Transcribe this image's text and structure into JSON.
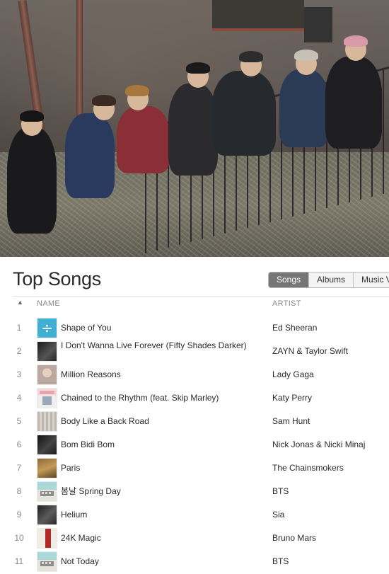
{
  "header": {
    "title": "Top Songs",
    "tabs": [
      {
        "label": "Songs",
        "active": true
      },
      {
        "label": "Albums",
        "active": false
      },
      {
        "label": "Music V",
        "active": false
      }
    ]
  },
  "table": {
    "columns": {
      "name": "NAME",
      "artist": "ARTIST"
    },
    "sort_indicator": "▲",
    "rows": [
      {
        "rank": "1",
        "name": "Shape of You",
        "artist": "Ed Sheeran"
      },
      {
        "rank": "2",
        "name": "I Don't Wanna Live Forever (Fifty Shades Darker)",
        "artist": "ZAYN & Taylor Swift"
      },
      {
        "rank": "3",
        "name": "Million Reasons",
        "artist": "Lady Gaga"
      },
      {
        "rank": "4",
        "name": "Chained to the Rhythm (feat. Skip Marley)",
        "artist": "Katy Perry"
      },
      {
        "rank": "5",
        "name": "Body Like a Back Road",
        "artist": "Sam Hunt"
      },
      {
        "rank": "6",
        "name": "Bom Bidi Bom",
        "artist": "Nick Jonas & Nicki Minaj"
      },
      {
        "rank": "7",
        "name": "Paris",
        "artist": "The Chainsmokers"
      },
      {
        "rank": "8",
        "name": "봄날 Spring Day",
        "artist": "BTS"
      },
      {
        "rank": "9",
        "name": "Helium",
        "artist": "Sia"
      },
      {
        "rank": "10",
        "name": "24K Magic",
        "artist": "Bruno Mars"
      },
      {
        "rank": "11",
        "name": "Not Today",
        "artist": "BTS"
      }
    ]
  },
  "colors": {
    "segment_active_bg": "#767676",
    "text_primary": "#2a2a2a",
    "text_secondary": "#8a8a8a"
  }
}
